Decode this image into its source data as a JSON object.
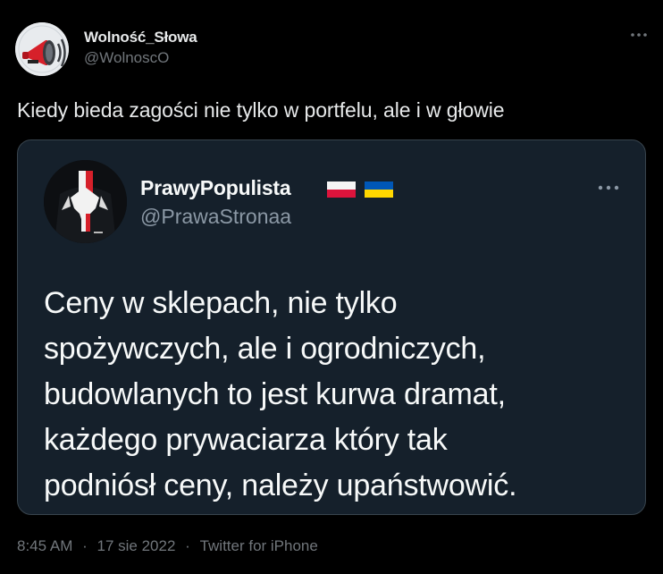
{
  "tweet": {
    "author": {
      "name": "Wolność_Słowa",
      "handle": "@WolnoscO",
      "avatar_icon": "megaphone-icon"
    },
    "text": "Kiedy bieda zagości nie tylko w portfelu, ale i w głowie",
    "more_icon": "more-horizontal-icon",
    "meta": {
      "time": "8:45 AM",
      "separator": "·",
      "date": "17 sie 2022",
      "source": "Twitter for iPhone"
    }
  },
  "quoted": {
    "author": {
      "name": "PrawyPopulista",
      "handle": "@PrawaStronaa",
      "avatar_icon": "eagle-emblem-icon",
      "flags": [
        "poland-flag-icon",
        "ukraine-flag-icon"
      ]
    },
    "text_lines": [
      "Ceny w sklepach, nie tylko",
      "spożywczych, ale i ogrodniczych,",
      "budowlanych to jest kurwa dramat,",
      "każdego prywaciarza który tak",
      "podniósł ceny, należy upaństwowić."
    ],
    "more_icon": "more-horizontal-icon"
  },
  "colors": {
    "background": "#000000",
    "card_background": "#15202b",
    "card_border": "#38444d",
    "primary_text": "#e7e9ea",
    "secondary_text": "#71767b",
    "accent_red": "#d6202a"
  }
}
